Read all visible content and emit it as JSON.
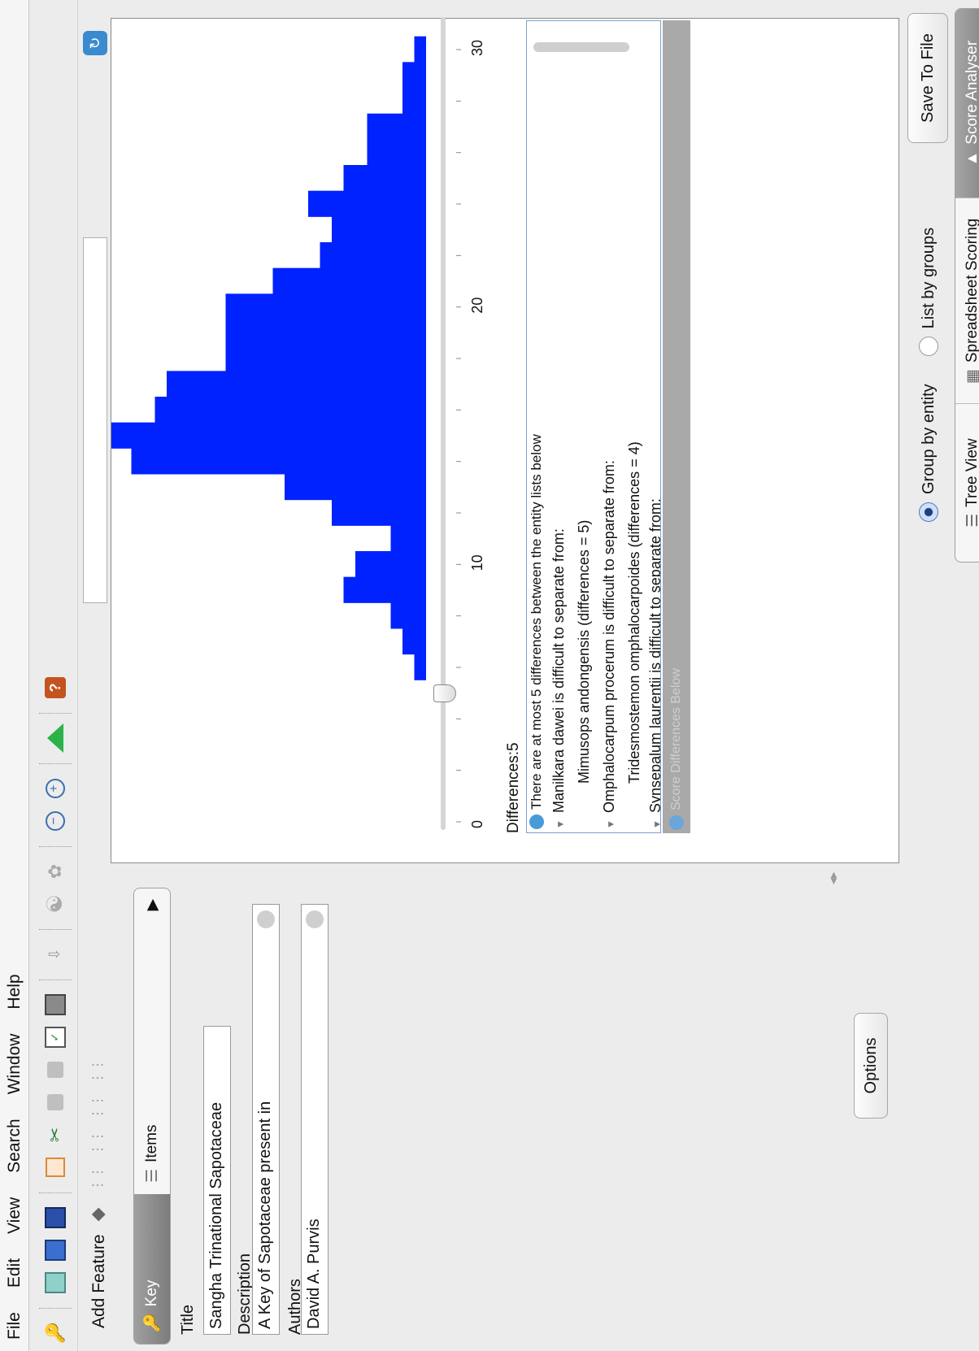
{
  "menu": [
    "File",
    "Edit",
    "View",
    "Search",
    "Window",
    "Help"
  ],
  "toolbar": {
    "icons": [
      "new-key-icon",
      "open-icon",
      "save-icon",
      "save-as-icon",
      "copy-icon",
      "cut-icon",
      "paste-icon",
      "delete-icon",
      "check-icon",
      "list-icon",
      "sort-az-icon",
      "find-icon",
      "taxon-icon",
      "collapse-icon",
      "expand-icon",
      "run-icon",
      "help-icon"
    ]
  },
  "left": {
    "add_feature": "Add Feature",
    "tabs": {
      "key": "Key",
      "items": "Items"
    },
    "title_label": "Title",
    "title_value": "Sangha Trinational Sapotaceae",
    "description_label": "Description",
    "description_value": "A  Key of Sapotaceae present in",
    "authors_label": "Authors",
    "authors_value": "David A. Purvis",
    "options": "Options"
  },
  "right": {
    "save_to_file": "Save To File",
    "differences_label": "Differences:5",
    "axis_ticks": [
      "0",
      "10",
      "20",
      "30"
    ],
    "summary": "There are at most 5 differences between the entity lists below",
    "tree": [
      {
        "text": "Manilkara dawei is difficult to separate from:",
        "level": 0
      },
      {
        "text": "Mimusops andongensis (differences = 5)",
        "level": 1
      },
      {
        "text": "Omphalocarpum procerum is difficult to separate from:",
        "level": 0
      },
      {
        "text": "Tridesmostemon omphalocarpoides (differences = 4)",
        "level": 1
      },
      {
        "text": "Synsepalum laurentii is difficult to separate from:",
        "level": 0
      }
    ],
    "faded_header": "Score Differences Below",
    "radio_group": "Group by entity",
    "radio_list": "List by groups",
    "bottom_tabs": [
      "Tree View",
      "Spreadsheet Scoring",
      "Score Analyser"
    ]
  },
  "chart_data": {
    "type": "bar",
    "xlabel": "",
    "ylabel": "",
    "xlim": [
      0,
      30
    ],
    "categories": [
      6,
      7,
      8,
      9,
      10,
      11,
      12,
      13,
      14,
      15,
      16,
      17,
      18,
      19,
      20,
      21,
      22,
      23,
      24,
      25,
      26,
      27,
      28,
      29,
      30
    ],
    "values": [
      1,
      2,
      3,
      7,
      6,
      3,
      8,
      12,
      25,
      27,
      23,
      22,
      17,
      17,
      17,
      13,
      9,
      8,
      10,
      7,
      5,
      5,
      2,
      2,
      1
    ],
    "color": "#0022ff",
    "slider_value": 5
  }
}
